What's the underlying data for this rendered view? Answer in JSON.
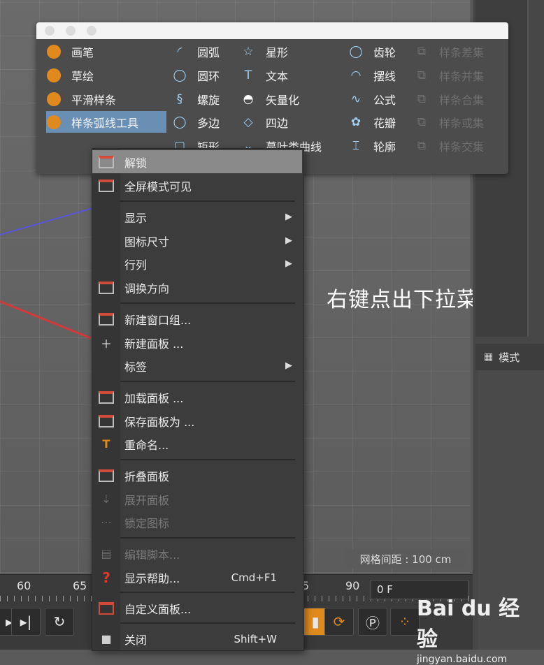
{
  "palette": {
    "col1": [
      {
        "label": "画笔",
        "icon": "pen-tool-icon"
      },
      {
        "label": "草绘",
        "icon": "sketch-icon"
      },
      {
        "label": "平滑样条",
        "icon": "smooth-spline-icon"
      },
      {
        "label": "样条弧线工具",
        "icon": "spline-arc-tool-icon",
        "selected": true
      }
    ],
    "col2": [
      {
        "label": "圆弧",
        "icon": "arc-icon"
      },
      {
        "label": "圆环",
        "icon": "circle-icon"
      },
      {
        "label": "螺旋",
        "icon": "helix-icon"
      },
      {
        "label": "多边",
        "icon": "polygon-icon"
      },
      {
        "label": "矩形",
        "icon": "rectangle-icon"
      }
    ],
    "col3": [
      {
        "label": "星形",
        "icon": "star-icon"
      },
      {
        "label": "文本",
        "icon": "text-icon"
      },
      {
        "label": "矢量化",
        "icon": "vectorizer-icon"
      },
      {
        "label": "四边",
        "icon": "four-side-icon"
      },
      {
        "label": "蔓叶类曲线",
        "icon": "cissoid-icon"
      }
    ],
    "col4": [
      {
        "label": "齿轮",
        "icon": "gear-icon"
      },
      {
        "label": "摆线",
        "icon": "cycloid-icon"
      },
      {
        "label": "公式",
        "icon": "formula-icon"
      },
      {
        "label": "花瓣",
        "icon": "flower-icon"
      },
      {
        "label": "轮廓",
        "icon": "profile-icon"
      }
    ],
    "col5": [
      {
        "label": "样条差集",
        "icon": "spline-subtract-icon"
      },
      {
        "label": "样条并集",
        "icon": "spline-union-icon"
      },
      {
        "label": "样条合集",
        "icon": "spline-and-icon"
      },
      {
        "label": "样条或集",
        "icon": "spline-or-icon"
      },
      {
        "label": "样条交集",
        "icon": "spline-intersect-icon"
      }
    ]
  },
  "menu": {
    "unlock": "解锁",
    "fullscreen_visible": "全屏模式可见",
    "display": "显示",
    "icon_size": "图标尺寸",
    "rows_columns": "行列",
    "swap_orientation": "调换方向",
    "new_group_window": "新建窗口组...",
    "new_palette": "新建面板 ...",
    "tabs": "标签",
    "load_palette": "加载面板 ...",
    "save_palette_as": "保存面板为 ...",
    "rename": "重命名...",
    "fold_palette": "折叠面板",
    "unfold_palette": "展开面板",
    "lock_icons": "锁定图标",
    "edit_script": "编辑脚本...",
    "show_help": "显示帮助...",
    "show_help_shortcut": "Cmd+F1",
    "customize_palettes": "自定义面板...",
    "close": "关闭",
    "close_shortcut": "Shift+W",
    "submenu_arrow": "▶"
  },
  "caption": "右键点出下拉菜单",
  "viewport": {
    "grid_spacing": "网格间距 : 100 cm"
  },
  "timeline": {
    "ticks": [
      "60",
      "65",
      "5",
      "90"
    ],
    "current_frame": "0 F"
  },
  "mode_panel": {
    "label": "模式"
  },
  "watermark": {
    "brand": "Bai du 经验",
    "url": "jingyan.baidu.com"
  }
}
